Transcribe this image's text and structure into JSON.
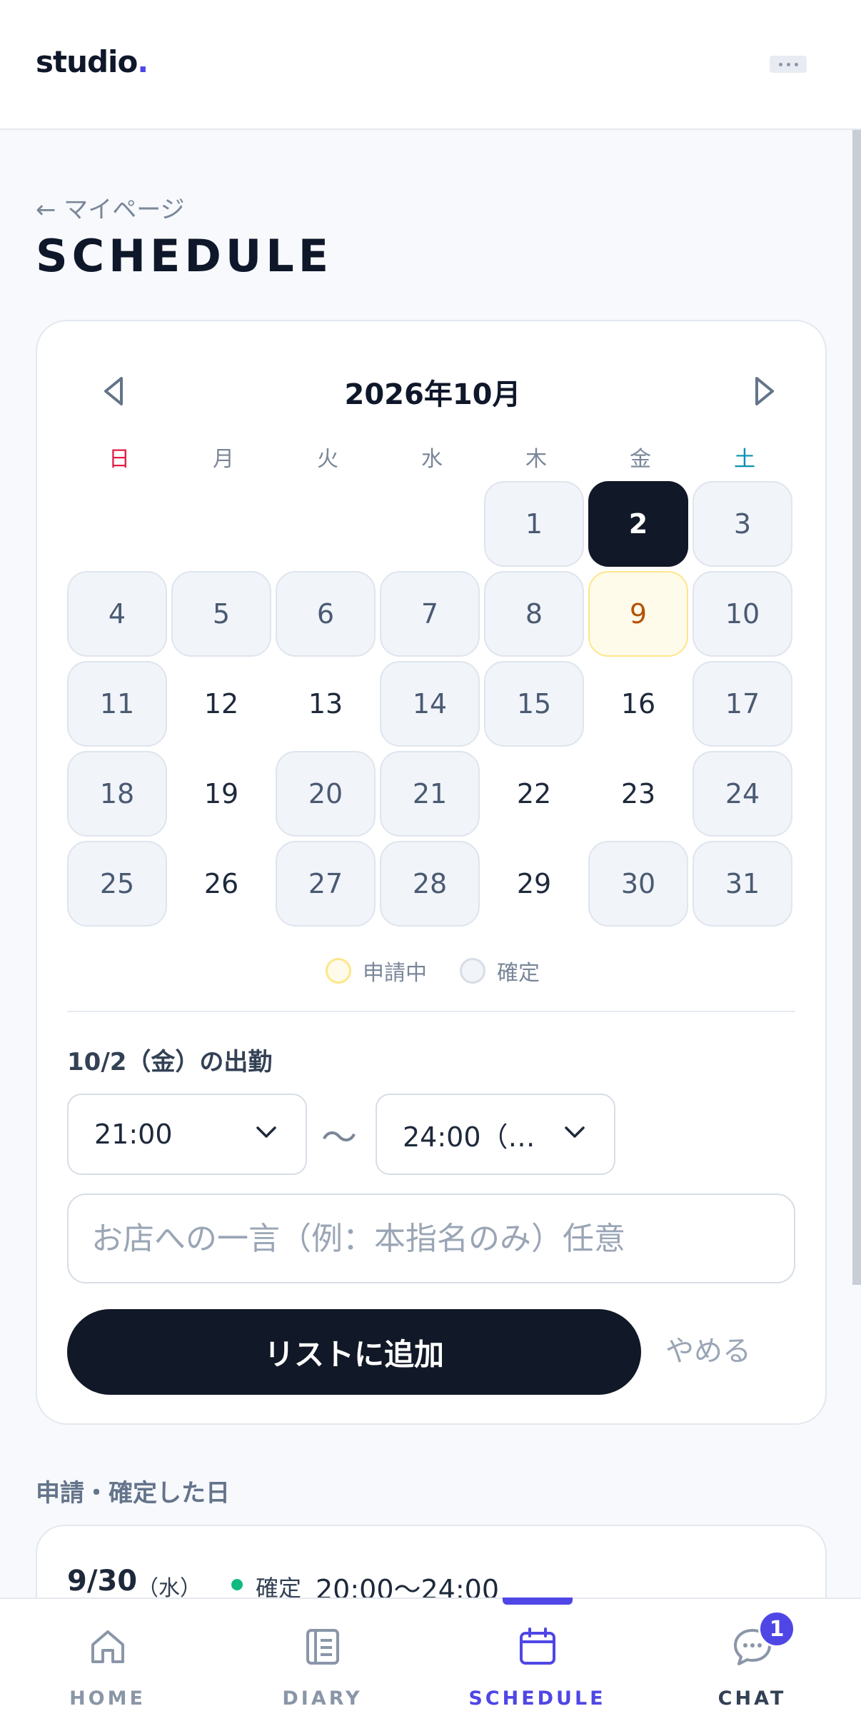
{
  "header": {
    "logo_text": "studio",
    "logo_dot": ".",
    "menu_icon": "more-icon"
  },
  "page": {
    "back_link": "← マイページ",
    "title": "SCHEDULE"
  },
  "calendar": {
    "month_title": "2026年10月",
    "weekdays": [
      "日",
      "月",
      "火",
      "水",
      "木",
      "金",
      "土"
    ],
    "leading_blanks": 4,
    "days": [
      {
        "d": "1",
        "state": "confirmed"
      },
      {
        "d": "2",
        "state": "selected"
      },
      {
        "d": "3",
        "state": "confirmed"
      },
      {
        "d": "4",
        "state": "confirmed"
      },
      {
        "d": "5",
        "state": "confirmed"
      },
      {
        "d": "6",
        "state": "confirmed"
      },
      {
        "d": "7",
        "state": "confirmed"
      },
      {
        "d": "8",
        "state": "confirmed"
      },
      {
        "d": "9",
        "state": "pending"
      },
      {
        "d": "10",
        "state": "confirmed"
      },
      {
        "d": "11",
        "state": "confirmed"
      },
      {
        "d": "12",
        "state": "none"
      },
      {
        "d": "13",
        "state": "none"
      },
      {
        "d": "14",
        "state": "confirmed"
      },
      {
        "d": "15",
        "state": "confirmed"
      },
      {
        "d": "16",
        "state": "none"
      },
      {
        "d": "17",
        "state": "confirmed"
      },
      {
        "d": "18",
        "state": "confirmed"
      },
      {
        "d": "19",
        "state": "none"
      },
      {
        "d": "20",
        "state": "confirmed"
      },
      {
        "d": "21",
        "state": "confirmed"
      },
      {
        "d": "22",
        "state": "none"
      },
      {
        "d": "23",
        "state": "none"
      },
      {
        "d": "24",
        "state": "confirmed"
      },
      {
        "d": "25",
        "state": "confirmed"
      },
      {
        "d": "26",
        "state": "none"
      },
      {
        "d": "27",
        "state": "confirmed"
      },
      {
        "d": "28",
        "state": "confirmed"
      },
      {
        "d": "29",
        "state": "none"
      },
      {
        "d": "30",
        "state": "confirmed"
      },
      {
        "d": "31",
        "state": "confirmed"
      }
    ],
    "legend": {
      "pending": "申請中",
      "confirmed": "確定"
    }
  },
  "shift_form": {
    "heading": "10/2（金）の出勤",
    "start_time": "21:00",
    "separator": "〜",
    "end_time": "24:00（…",
    "comment_placeholder": "お店への一言（例：本指名のみ）任意",
    "add_button": "リストに追加",
    "cancel_button": "やめる"
  },
  "applied": {
    "section_label": "申請・確定した日",
    "entries": [
      {
        "date": "9/30",
        "weekday": "（水）",
        "status": "確定",
        "time": "20:00〜24:00"
      }
    ]
  },
  "bottom_nav": {
    "items": [
      {
        "label": "HOME",
        "icon": "home-icon"
      },
      {
        "label": "DIARY",
        "icon": "diary-icon"
      },
      {
        "label": "SCHEDULE",
        "icon": "calendar-icon",
        "active": true
      },
      {
        "label": "CHAT",
        "icon": "chat-icon",
        "badge": "1"
      }
    ]
  },
  "colors": {
    "accent": "#4f46e5",
    "dark": "#111827",
    "pending_border": "#fde68a",
    "confirmed_bg": "#f1f4f9",
    "status_dot": "#10b981"
  }
}
